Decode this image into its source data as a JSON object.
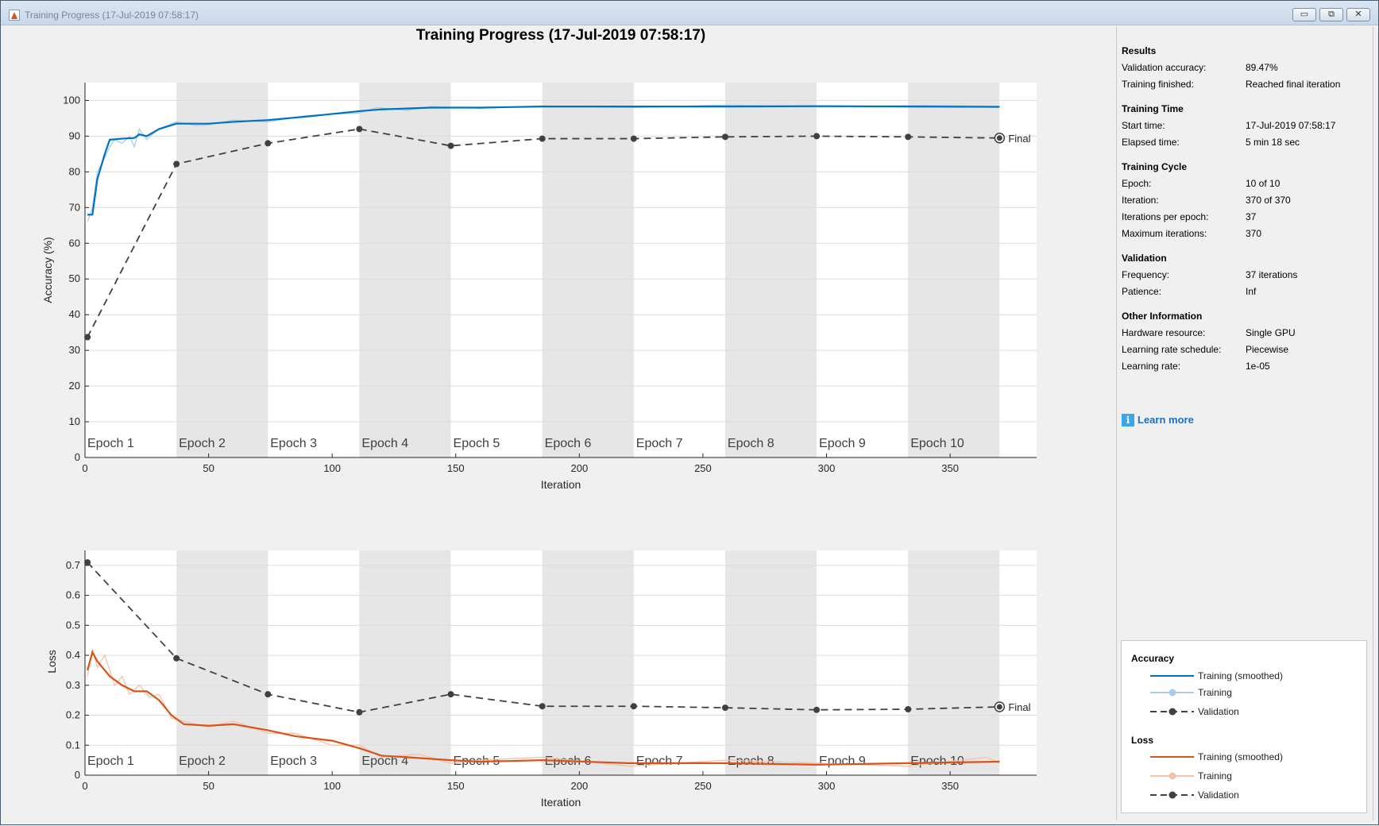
{
  "window": {
    "title": "Training Progress (17-Jul-2019 07:58:17)",
    "minimize": "▭",
    "maximize": "⧉",
    "close": "✕"
  },
  "plot_title": "Training Progress (17-Jul-2019 07:58:17)",
  "sidebar": {
    "sections": [
      {
        "title": "Results",
        "rows": [
          [
            "Validation accuracy:",
            "89.47%"
          ],
          [
            "Training finished:",
            "Reached final iteration"
          ]
        ]
      },
      {
        "title": "Training Time",
        "rows": [
          [
            "Start time:",
            "17-Jul-2019 07:58:17"
          ],
          [
            "Elapsed time:",
            "5 min 18 sec"
          ]
        ]
      },
      {
        "title": "Training Cycle",
        "rows": [
          [
            "Epoch:",
            "10 of 10"
          ],
          [
            "Iteration:",
            "370 of 370"
          ],
          [
            "Iterations per epoch:",
            "37"
          ],
          [
            "Maximum iterations:",
            "370"
          ]
        ]
      },
      {
        "title": "Validation",
        "rows": [
          [
            "Frequency:",
            "37 iterations"
          ],
          [
            "Patience:",
            "Inf"
          ]
        ]
      },
      {
        "title": "Other Information",
        "rows": [
          [
            "Hardware resource:",
            "Single GPU"
          ],
          [
            "Learning rate schedule:",
            "Piecewise"
          ],
          [
            "Learning rate:",
            "1e-05"
          ]
        ]
      }
    ],
    "learn_more": "Learn more",
    "info_icon": "i"
  },
  "legend": {
    "accuracy_title": "Accuracy",
    "loss_title": "Loss",
    "items": [
      "Training (smoothed)",
      "Training",
      "Validation"
    ]
  },
  "colors": {
    "acc_smooth": "#0072bd",
    "acc_raw": "#a6cde9",
    "loss_smooth": "#d95319",
    "loss_raw": "#f2c2ab",
    "validation": "#404040",
    "band": "#e6e6e6"
  },
  "chart_data": [
    {
      "type": "line",
      "title": "Training Progress (17-Jul-2019 07:58:17)",
      "xlabel": "Iteration",
      "ylabel": "Accuracy (%)",
      "xlim": [
        0,
        385
      ],
      "ylim": [
        0,
        105
      ],
      "xticks": [
        0,
        50,
        100,
        150,
        200,
        250,
        300,
        350
      ],
      "yticks": [
        0,
        10,
        20,
        30,
        40,
        50,
        60,
        70,
        80,
        90,
        100
      ],
      "epochs": [
        "Epoch 1",
        "Epoch 2",
        "Epoch 3",
        "Epoch 4",
        "Epoch 5",
        "Epoch 6",
        "Epoch 7",
        "Epoch 8",
        "Epoch 9",
        "Epoch 10"
      ],
      "iters_per_epoch": 37,
      "final_label": "Final",
      "series": [
        {
          "name": "Training (smoothed)",
          "x": [
            1,
            3,
            5,
            8,
            10,
            15,
            20,
            22,
            25,
            30,
            37,
            50,
            60,
            74,
            90,
            111,
            120,
            140,
            160,
            185,
            220,
            259,
            300,
            370
          ],
          "y": [
            68,
            68,
            78,
            85,
            89,
            89.3,
            89.5,
            90.5,
            90,
            92,
            93.5,
            93.5,
            94,
            94.5,
            95.5,
            97,
            97.5,
            98,
            98,
            98.3,
            98.3,
            98.3,
            98.4,
            98.2
          ]
        },
        {
          "name": "Training",
          "x": [
            1,
            3,
            5,
            8,
            10,
            12,
            15,
            18,
            20,
            22,
            25,
            28,
            30,
            37,
            45,
            50,
            60,
            74,
            90,
            111,
            118,
            130,
            140,
            160,
            185,
            220,
            259,
            300,
            340,
            370
          ],
          "y": [
            66,
            70,
            80,
            84,
            87,
            89,
            88,
            90,
            87,
            92,
            89,
            91,
            92,
            94,
            93,
            93.2,
            94.5,
            94,
            95.8,
            96.5,
            98,
            97.2,
            98.3,
            97.8,
            98.5,
            98,
            98.7,
            98.2,
            98.6,
            98.4
          ]
        },
        {
          "name": "Validation",
          "x": [
            1,
            37,
            74,
            111,
            148,
            185,
            222,
            259,
            296,
            333,
            370
          ],
          "y": [
            33.7,
            82.2,
            88,
            92,
            87.3,
            89.3,
            89.3,
            89.8,
            90,
            89.8,
            89.47
          ]
        }
      ]
    },
    {
      "type": "line",
      "xlabel": "Iteration",
      "ylabel": "Loss",
      "xlim": [
        0,
        385
      ],
      "ylim": [
        0,
        0.75
      ],
      "xticks": [
        0,
        50,
        100,
        150,
        200,
        250,
        300,
        350
      ],
      "yticks": [
        0,
        0.1,
        0.2,
        0.3,
        0.4,
        0.5,
        0.6,
        0.7
      ],
      "epochs": [
        "Epoch 1",
        "Epoch 2",
        "Epoch 3",
        "Epoch 4",
        "Epoch 5",
        "Epoch 6",
        "Epoch 7",
        "Epoch 8",
        "Epoch 9",
        "Epoch 10"
      ],
      "iters_per_epoch": 37,
      "final_label": "Final",
      "series": [
        {
          "name": "Training (smoothed)",
          "x": [
            1,
            3,
            5,
            10,
            15,
            20,
            25,
            30,
            35,
            40,
            50,
            60,
            74,
            85,
            100,
            111,
            120,
            130,
            148,
            160,
            185,
            220,
            259,
            296,
            333,
            370
          ],
          "y": [
            0.35,
            0.41,
            0.38,
            0.33,
            0.3,
            0.28,
            0.28,
            0.25,
            0.2,
            0.17,
            0.165,
            0.17,
            0.15,
            0.13,
            0.115,
            0.09,
            0.065,
            0.06,
            0.05,
            0.045,
            0.05,
            0.04,
            0.04,
            0.035,
            0.04,
            0.045
          ]
        },
        {
          "name": "Training",
          "x": [
            1,
            3,
            5,
            8,
            12,
            15,
            18,
            22,
            26,
            30,
            35,
            40,
            50,
            60,
            74,
            85,
            100,
            111,
            120,
            135,
            148,
            160,
            185,
            220,
            259,
            296,
            333,
            365,
            370
          ],
          "y": [
            0.33,
            0.42,
            0.36,
            0.4,
            0.3,
            0.33,
            0.27,
            0.3,
            0.26,
            0.27,
            0.19,
            0.18,
            0.16,
            0.18,
            0.14,
            0.14,
            0.1,
            0.1,
            0.06,
            0.07,
            0.04,
            0.05,
            0.06,
            0.03,
            0.05,
            0.04,
            0.03,
            0.06,
            0.04
          ]
        },
        {
          "name": "Validation",
          "x": [
            1,
            37,
            74,
            111,
            148,
            185,
            222,
            259,
            296,
            333,
            370
          ],
          "y": [
            0.71,
            0.39,
            0.27,
            0.21,
            0.27,
            0.23,
            0.23,
            0.225,
            0.218,
            0.22,
            0.228
          ]
        }
      ]
    }
  ]
}
